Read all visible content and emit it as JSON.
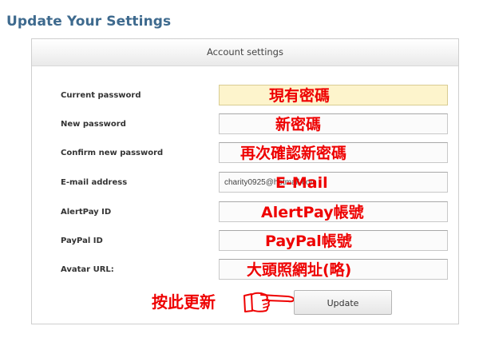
{
  "page": {
    "title": "Update Your Settings"
  },
  "panel": {
    "header": "Account settings"
  },
  "fields": [
    {
      "label": "Current password",
      "value": "",
      "note": "現有密碼"
    },
    {
      "label": "New password",
      "value": "",
      "note": "新密碼"
    },
    {
      "label": "Confirm new password",
      "value": "",
      "note": "再次確認新密碼"
    },
    {
      "label": "E-mail address",
      "value": "charity0925@hotmail.com",
      "note": "E-Mail"
    },
    {
      "label": "AlertPay ID",
      "value": "",
      "note": "AlertPay帳號"
    },
    {
      "label": "PayPal ID",
      "value": "",
      "note": "PayPal帳號"
    },
    {
      "label": "Avatar URL:",
      "value": "",
      "note": "大頭照網址(略)"
    }
  ],
  "actions": {
    "update_label": "Update",
    "click_note": "按此更新"
  },
  "colors": {
    "title": "#3e6a8e",
    "annotation": "#ee0000",
    "focused_input": "#fdf4cc"
  },
  "icons": {
    "pointer": "pointing-hand-icon"
  }
}
